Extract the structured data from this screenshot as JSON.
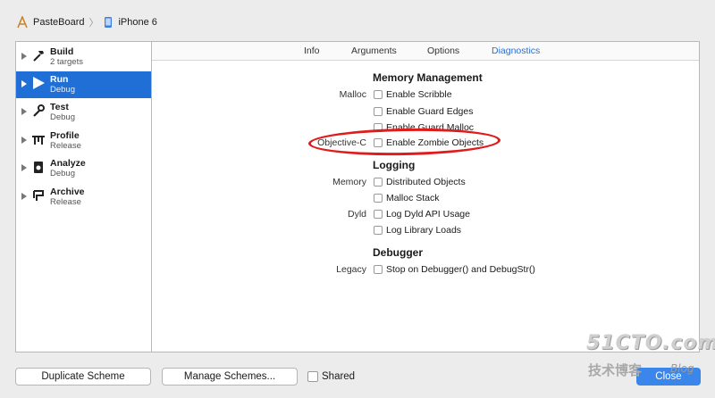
{
  "breadcrumb": {
    "project": "PasteBoard",
    "device": "iPhone 6",
    "project_icon": "xcode-app-icon",
    "device_icon": "iphone-icon"
  },
  "sidebar": {
    "items": [
      {
        "title": "Build",
        "subtitle": "2 targets",
        "icon": "hammer-icon",
        "selected": false
      },
      {
        "title": "Run",
        "subtitle": "Debug",
        "icon": "play-icon",
        "selected": true
      },
      {
        "title": "Test",
        "subtitle": "Debug",
        "icon": "wrench-icon",
        "selected": false
      },
      {
        "title": "Profile",
        "subtitle": "Release",
        "icon": "instruments-icon",
        "selected": false
      },
      {
        "title": "Analyze",
        "subtitle": "Debug",
        "icon": "analyze-icon",
        "selected": false
      },
      {
        "title": "Archive",
        "subtitle": "Release",
        "icon": "archive-icon",
        "selected": false
      }
    ]
  },
  "tabs": [
    {
      "label": "Info",
      "active": false
    },
    {
      "label": "Arguments",
      "active": false
    },
    {
      "label": "Options",
      "active": false
    },
    {
      "label": "Diagnostics",
      "active": true
    }
  ],
  "diagnostics": {
    "memory_management": {
      "title": "Memory Management",
      "malloc_label": "Malloc",
      "objc_label": "Objective-C",
      "options": [
        {
          "label": "Enable Scribble",
          "checked": false
        },
        {
          "label": "Enable Guard Edges",
          "checked": false
        },
        {
          "label": "Enable Guard Malloc",
          "checked": false
        },
        {
          "label": "Enable Zombie Objects",
          "checked": false
        }
      ]
    },
    "logging": {
      "title": "Logging",
      "memory_label": "Memory",
      "dyld_label": "Dyld",
      "options": [
        {
          "label": "Distributed Objects",
          "checked": false
        },
        {
          "label": "Malloc Stack",
          "checked": false
        },
        {
          "label": "Log Dyld API Usage",
          "checked": false
        },
        {
          "label": "Log Library Loads",
          "checked": false
        }
      ]
    },
    "debugger": {
      "title": "Debugger",
      "legacy_label": "Legacy",
      "options": [
        {
          "label": "Stop on Debugger() and DebugStr()",
          "checked": false
        }
      ]
    }
  },
  "footer": {
    "duplicate_label": "Duplicate Scheme",
    "manage_label": "Manage Schemes...",
    "shared_label": "Shared",
    "shared_checked": false,
    "close_label": "Close"
  },
  "watermark": {
    "site": "51CTO.com",
    "tagline": "技术博客",
    "blog": "Blog"
  },
  "colors": {
    "accent": "#1f6fd6",
    "active_tab": "#2a6fd1",
    "highlight_ring": "#e01b1b",
    "close_button": "#3a86ea"
  }
}
